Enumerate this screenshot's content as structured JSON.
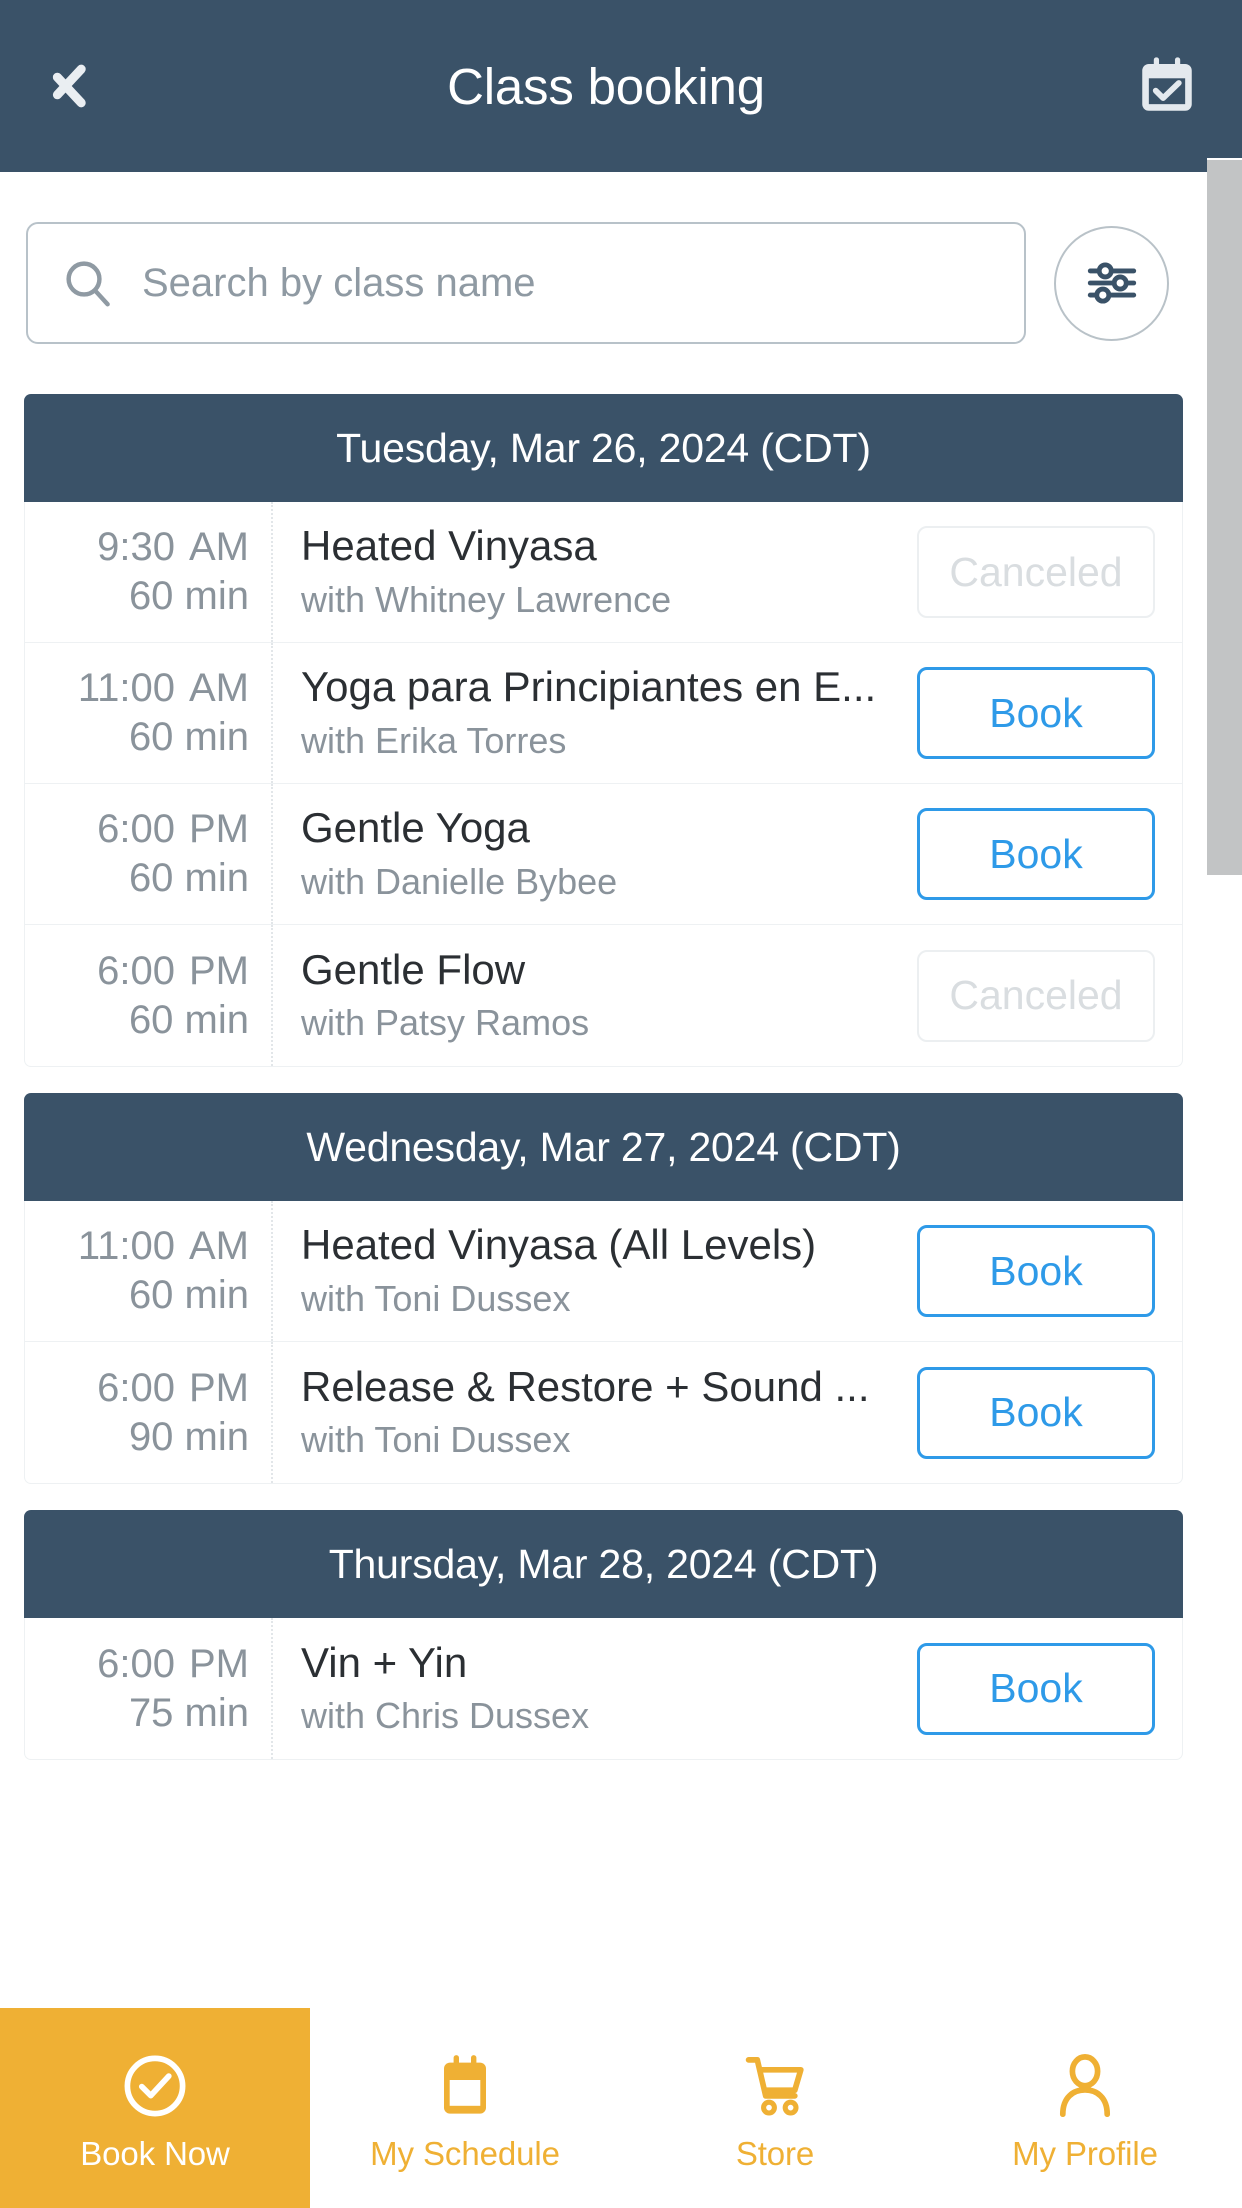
{
  "header": {
    "title": "Class booking",
    "back_icon": "chevron-left-icon",
    "calendar_icon": "calendar-check-icon"
  },
  "search": {
    "placeholder": "Search by class name",
    "value": "",
    "search_icon": "search-icon",
    "filter_icon": "filter-sliders-icon"
  },
  "colors": {
    "header_bg": "#3a5268",
    "day_header_bg": "#3a5268",
    "book_blue": "#2e9ae8",
    "canceled_gray": "#d9dde0",
    "nav_amber": "#efb034",
    "muted_text": "#8a939b",
    "title_text": "#2b2f33"
  },
  "days": [
    {
      "label": "Tuesday, Mar 26, 2024 (CDT)",
      "classes": [
        {
          "time": "9:30",
          "ampm": "AM",
          "duration": "60 min",
          "name": "Heated Vinyasa",
          "teacher": "with Whitney Lawrence",
          "action": "Canceled",
          "state": "canceled"
        },
        {
          "time": "11:00",
          "ampm": "AM",
          "duration": "60 min",
          "name": "Yoga para Principiantes en E...",
          "teacher": "with Erika Torres",
          "action": "Book",
          "state": "bookable"
        },
        {
          "time": "6:00",
          "ampm": "PM",
          "duration": "60 min",
          "name": "Gentle Yoga",
          "teacher": "with Danielle Bybee",
          "action": "Book",
          "state": "bookable"
        },
        {
          "time": "6:00",
          "ampm": "PM",
          "duration": "60 min",
          "name": "Gentle Flow",
          "teacher": "with Patsy Ramos",
          "action": "Canceled",
          "state": "canceled"
        }
      ]
    },
    {
      "label": "Wednesday, Mar 27, 2024 (CDT)",
      "classes": [
        {
          "time": "11:00",
          "ampm": "AM",
          "duration": "60 min",
          "name": "Heated Vinyasa (All Levels)",
          "teacher": "with Toni Dussex",
          "action": "Book",
          "state": "bookable"
        },
        {
          "time": "6:00",
          "ampm": "PM",
          "duration": "90 min",
          "name": "Release & Restore + Sound ...",
          "teacher": "with Toni Dussex",
          "action": "Book",
          "state": "bookable"
        }
      ]
    },
    {
      "label": "Thursday, Mar 28, 2024 (CDT)",
      "classes": [
        {
          "time": "6:00",
          "ampm": "PM",
          "duration": "75 min",
          "name": "Vin + Yin",
          "teacher": "with Chris Dussex",
          "action": "Book",
          "state": "bookable"
        }
      ]
    }
  ],
  "navbar": {
    "items": [
      {
        "label": "Book Now",
        "icon": "check-circle-icon",
        "active": true
      },
      {
        "label": "My Schedule",
        "icon": "calendar-icon",
        "active": false
      },
      {
        "label": "Store",
        "icon": "shopping-cart-icon",
        "active": false
      },
      {
        "label": "My Profile",
        "icon": "person-icon",
        "active": false
      }
    ]
  }
}
